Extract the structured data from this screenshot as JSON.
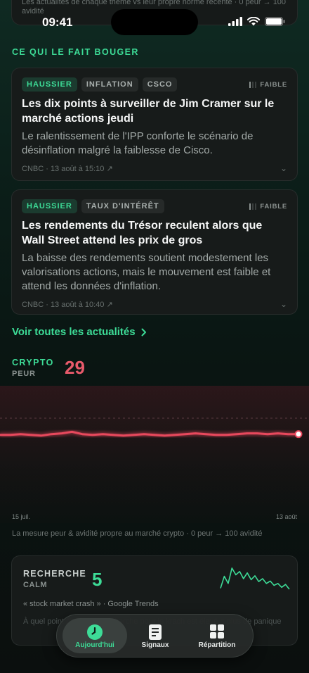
{
  "status_bar": {
    "time": "09:41"
  },
  "top_card": {
    "text": "Les actualités de chaque thème vs leur propre norme récente · 0 peur → 100 avidité"
  },
  "section_title": "CE QUI LE FAIT BOUGER",
  "news": [
    {
      "tags": [
        "HAUSSIER",
        "INFLATION",
        "CSCO"
      ],
      "strength": "FAIBLE",
      "title": "Les dix points à surveiller de Jim Cramer sur le marché actions jeudi",
      "summary": "Le ralentissement de l'IPP conforte le scénario de désinflation malgré la faiblesse de Cisco.",
      "meta": "CNBC · 13 août à 15:10 ↗"
    },
    {
      "tags": [
        "HAUSSIER",
        "TAUX D'INTÉRÊT"
      ],
      "strength": "FAIBLE",
      "title": "Les rendements du Trésor reculent alors que Wall Street attend les prix de gros",
      "summary": "La baisse des rendements soutient modestement les valorisations actions, mais le mouvement est faible et attend les données d'inflation.",
      "meta": "CNBC · 13 août à 10:40 ↗"
    }
  ],
  "see_all": "Voir toutes les actualités",
  "crypto": {
    "label": "CRYPTO",
    "mood": "PEUR",
    "value": "29",
    "axis_start": "15 juil.",
    "axis_end": "13 août",
    "caption": "La mesure peur & avidité propre au marché crypto · 0 peur → 100 avidité"
  },
  "chart_data": {
    "type": "line",
    "title": "",
    "xlabel": "",
    "ylabel": "",
    "x_range": [
      "15 juil.",
      "13 août"
    ],
    "ylim": [
      0,
      100
    ],
    "reference_line": 50,
    "series": [
      {
        "values": [
          28,
          28,
          29,
          28,
          27,
          29,
          30,
          32,
          29,
          28,
          29,
          28,
          27,
          28,
          29,
          28,
          27,
          28,
          29,
          30,
          29,
          28,
          28,
          29,
          30,
          30,
          29,
          30,
          29,
          29
        ]
      }
    ],
    "color": "#e8485d"
  },
  "search": {
    "label": "RECHERCHE",
    "mood": "CALM",
    "value": "5",
    "query": "« stock market crash » · Google Trends",
    "faded_text": "À quel point l'intérêt de recherche pour le krach est élevé = plus de panique",
    "sparkline": [
      20,
      45,
      30,
      62,
      48,
      55,
      40,
      52,
      38,
      46,
      34,
      40,
      30,
      35,
      26,
      30,
      22,
      28,
      18
    ]
  },
  "tabs": [
    {
      "label": "Aujourd'hui",
      "active": true
    },
    {
      "label": "Signaux",
      "active": false
    },
    {
      "label": "Répartition",
      "active": false
    }
  ],
  "colors": {
    "accent": "#3ddc97",
    "fear": "#e85a6b"
  }
}
